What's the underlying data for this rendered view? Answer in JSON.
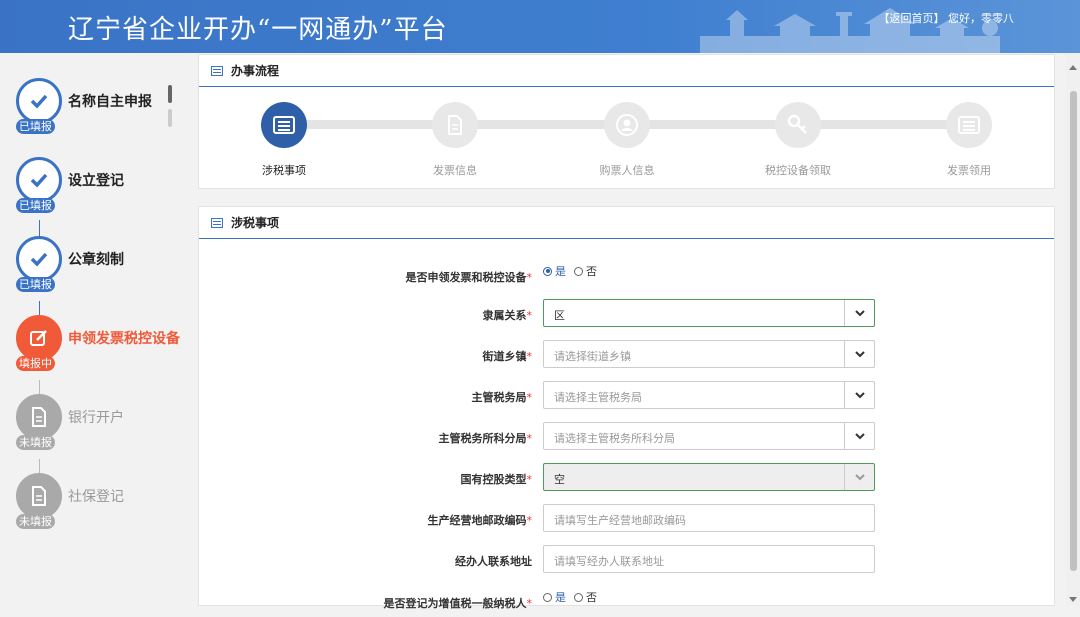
{
  "header": {
    "title": "辽宁省企业开办“一网通办”平台",
    "back_link": "【返回首页】",
    "greeting": "您好，零零八"
  },
  "steps": [
    {
      "label": "名称自主申报",
      "status": "已填报",
      "icon": "check-icon"
    },
    {
      "label": "设立登记",
      "status": "已填报",
      "icon": "check-icon"
    },
    {
      "label": "公章刻制",
      "status": "已填报",
      "icon": "check-icon"
    },
    {
      "label": "申领发票税控设备",
      "status": "填报中",
      "icon": "edit-icon"
    },
    {
      "label": "银行开户",
      "status": "未填报",
      "icon": "document-icon"
    },
    {
      "label": "社保登记",
      "status": "未填报",
      "icon": "document-icon"
    }
  ],
  "flow_panel": {
    "title": "办事流程",
    "nodes": [
      {
        "label": "涉税事项",
        "active": true,
        "icon": "list-icon"
      },
      {
        "label": "发票信息",
        "active": false,
        "icon": "document-icon"
      },
      {
        "label": "购票人信息",
        "active": false,
        "icon": "user-icon"
      },
      {
        "label": "税控设备领取",
        "active": false,
        "icon": "key-icon"
      },
      {
        "label": "发票领用",
        "active": false,
        "icon": "list-icon"
      }
    ]
  },
  "tax_panel": {
    "title": "涉税事项",
    "apply_invoice": {
      "label": "是否申领发票和税控设备",
      "required": "*",
      "options": [
        "是",
        "否"
      ],
      "selected": "是"
    },
    "affiliation": {
      "label": "隶属关系",
      "required": "*",
      "value": "区"
    },
    "street": {
      "label": "街道乡镇",
      "required": "*",
      "placeholder": "请选择街道乡镇"
    },
    "tax_bureau": {
      "label": "主管税务局",
      "required": "*",
      "placeholder": "请选择主管税务局"
    },
    "tax_branch": {
      "label": "主管税务所科分局",
      "required": "*",
      "placeholder": "请选择主管税务所科分局"
    },
    "state_holding": {
      "label": "国有控股类型",
      "required": "*",
      "value": "空"
    },
    "postal_code": {
      "label": "生产经营地邮政编码",
      "required": "*",
      "placeholder": "请填写生产经营地邮政编码"
    },
    "agent_address": {
      "label": "经办人联系地址",
      "required": "",
      "placeholder": "请填写经办人联系地址"
    },
    "vat_general": {
      "label": "是否登记为增值税一般纳税人",
      "required": "*",
      "options": [
        "是",
        "否"
      ],
      "selected": ""
    }
  }
}
